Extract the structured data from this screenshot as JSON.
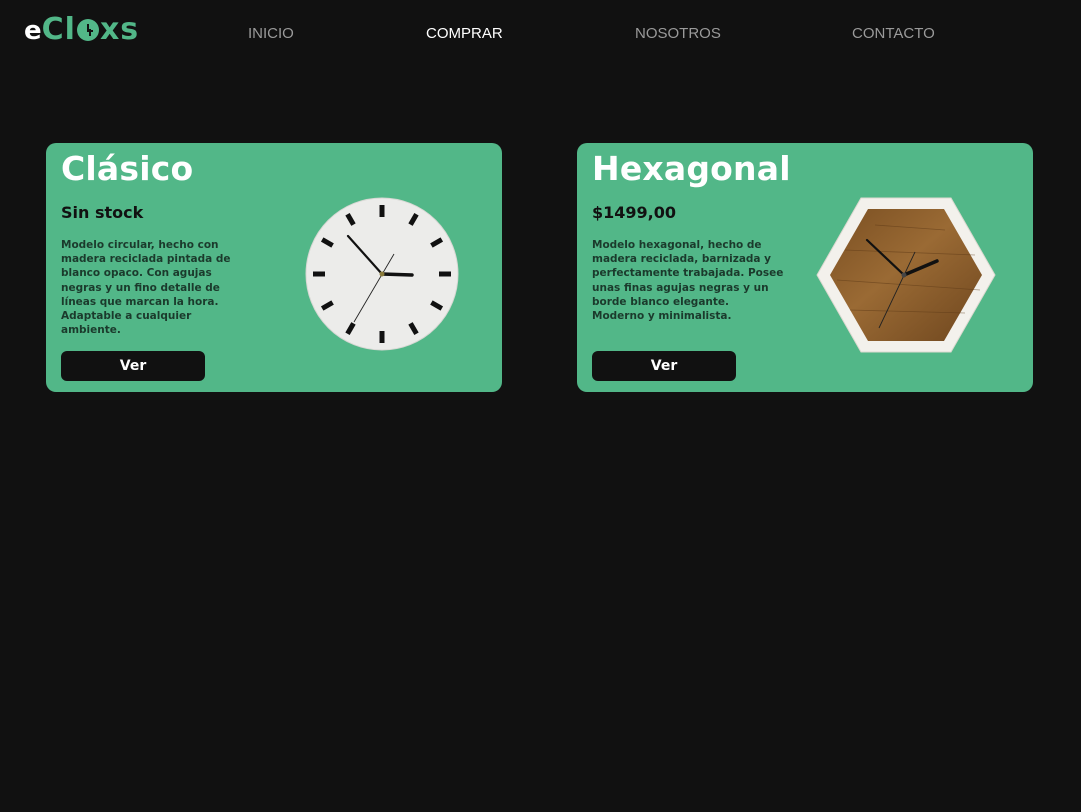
{
  "brand": {
    "logo_e": "e",
    "logo_c": "Cl",
    "logo_rest": "xs",
    "accent_color": "#52b788"
  },
  "nav": {
    "items": [
      {
        "label": "INICIO",
        "active": false
      },
      {
        "label": "COMPRAR",
        "active": true
      },
      {
        "label": "NOSOTROS",
        "active": false
      },
      {
        "label": "CONTACTO",
        "active": false
      }
    ]
  },
  "products": [
    {
      "title": "Clásico",
      "price": "Sin stock",
      "description": "Modelo circular, hecho con madera reciclada pintada de blanco opaco. Con agujas negras y un fino detalle de líneas que marcan la hora. Adaptable a cualquier ambiente.",
      "button_label": "Ver",
      "image_icon": "round-white-wall-clock"
    },
    {
      "title": "Hexagonal",
      "price": "$1499,00",
      "description": "Modelo hexagonal, hecho de madera reciclada, barnizada y perfectamente trabajada. Posee unas finas agujas negras y un borde blanco elegante. Moderno y minimalista.",
      "button_label": "Ver",
      "image_icon": "hexagonal-wood-wall-clock"
    }
  ],
  "colors": {
    "background": "#111111",
    "card": "#52b788",
    "button": "#111111"
  }
}
